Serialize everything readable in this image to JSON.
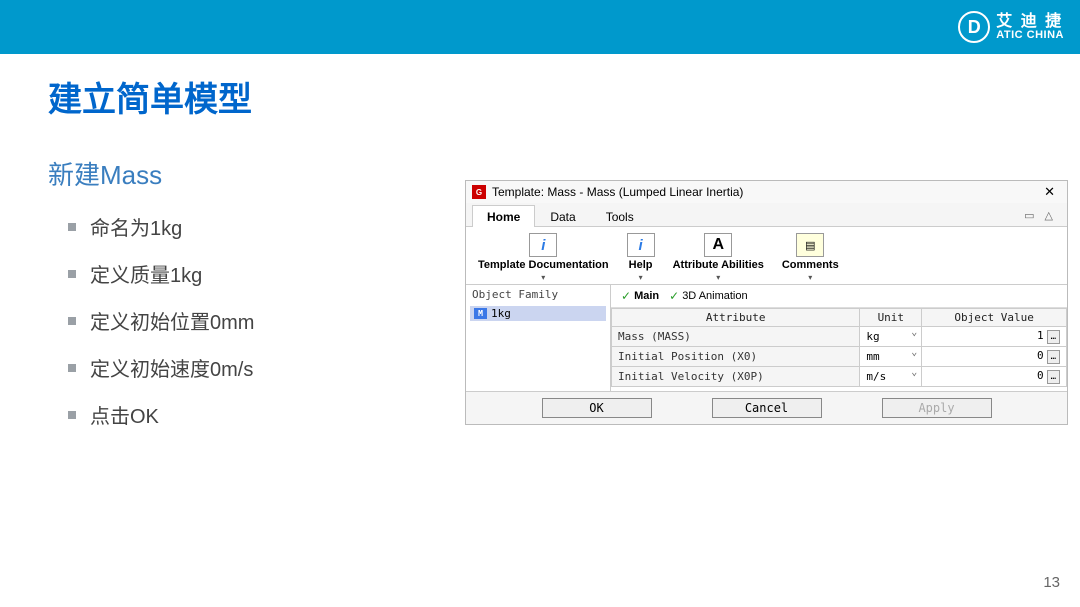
{
  "brand": {
    "mark": "D",
    "cn": "艾 迪 捷",
    "en": "ATIC CHINA"
  },
  "slide": {
    "title": "建立简单模型",
    "subtitle": "新建Mass",
    "bullets": [
      "命名为1kg",
      "定义质量1kg",
      "定义初始位置0mm",
      "定义初始速度0m/s",
      "点击OK"
    ],
    "page": "13"
  },
  "dialog": {
    "title": "Template: Mass - Mass (Lumped Linear Inertia)",
    "tabs": {
      "home": "Home",
      "data": "Data",
      "tools": "Tools"
    },
    "ribbon": {
      "doc": "Template Documentation",
      "help": "Help",
      "attr": "Attribute Abilities",
      "comments": "Comments"
    },
    "tree": {
      "header": "Object Family",
      "item": "1kg",
      "item_icon": "M"
    },
    "subtabs": {
      "main": "Main",
      "anim": "3D Animation"
    },
    "tableHeaders": {
      "attr": "Attribute",
      "unit": "Unit",
      "val": "Object Value"
    },
    "rows": [
      {
        "attr": "Mass (MASS)",
        "unit": "kg",
        "val": "1"
      },
      {
        "attr": "Initial Position (X0)",
        "unit": "mm",
        "val": "0"
      },
      {
        "attr": "Initial Velocity (X0P)",
        "unit": "m/s",
        "val": "0"
      }
    ],
    "buttons": {
      "ok": "OK",
      "cancel": "Cancel",
      "apply": "Apply"
    }
  }
}
